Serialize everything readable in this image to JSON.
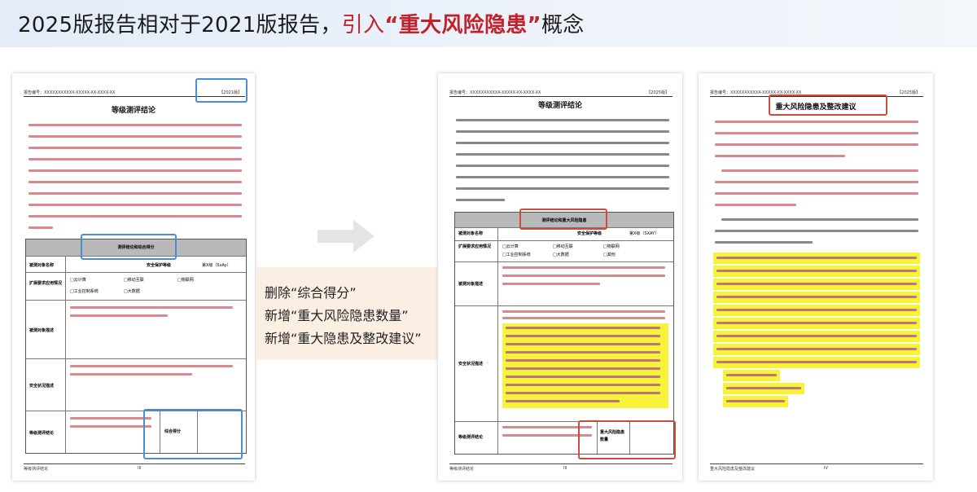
{
  "header": {
    "title_prefix": "2025版报告相对于2021版报告，",
    "title_red_normal": "引入",
    "title_red_bold": "“重大风险隐患”",
    "title_suffix": "概念"
  },
  "page1": {
    "header_left": "报告编号：XXXXXXXXXXX-XXXXX-XX-XXXX-XX",
    "header_right": "【2021版】",
    "title": "等级测评结论",
    "table_header": "测评结论和综合得分",
    "row_labels": [
      "被测对象名称",
      "扩展要求应用情况",
      "被测对象描述",
      "安全状况描述",
      "等级测评结论"
    ],
    "protect_level_label": "安全保护等级",
    "protect_level_value": "第X级（SxAy）",
    "options": [
      "□云计算",
      "□移动互联",
      "□物联网",
      "□工业控制系统",
      "□大数据"
    ],
    "score_label": "综合得分",
    "footer_left": "等级测评结论",
    "footer_right": "III"
  },
  "note": {
    "line1": "删除“综合得分”",
    "line2": "新增“重大风险隐患数量”",
    "line3": "新增“重大隐患及整改建议”"
  },
  "page2": {
    "header_left": "报告编号：XXXXXXXXXXX-XXXXX-XX-XXXX-XX",
    "header_right": "【2025版】",
    "title": "等级测评结论",
    "table_header": "测评结论和重大风险隐患",
    "row_labels": [
      "被测对象名称",
      "扩展要求应用情况",
      "被测对象描述",
      "安全状况描述",
      "等级测评结论"
    ],
    "protect_level_label": "安全保护等级",
    "protect_level_value": "第X级（SXAY）",
    "options": [
      "□云计算",
      "□移动互联",
      "□物联网",
      "□工业控制系统",
      "□大数据",
      "□其他"
    ],
    "risk_label": "重大风险隐患数量",
    "footer_left": "等级测评结论",
    "footer_right": "III"
  },
  "page3": {
    "header_left": "报告编号：XXXXXXXXXXX-XXXXX-XX-XXXX-XX",
    "header_right": "【2025版】",
    "title": "重大风险隐患及整改建议",
    "footer_left": "重大风险隐患及整改建议",
    "footer_right": "IV"
  }
}
